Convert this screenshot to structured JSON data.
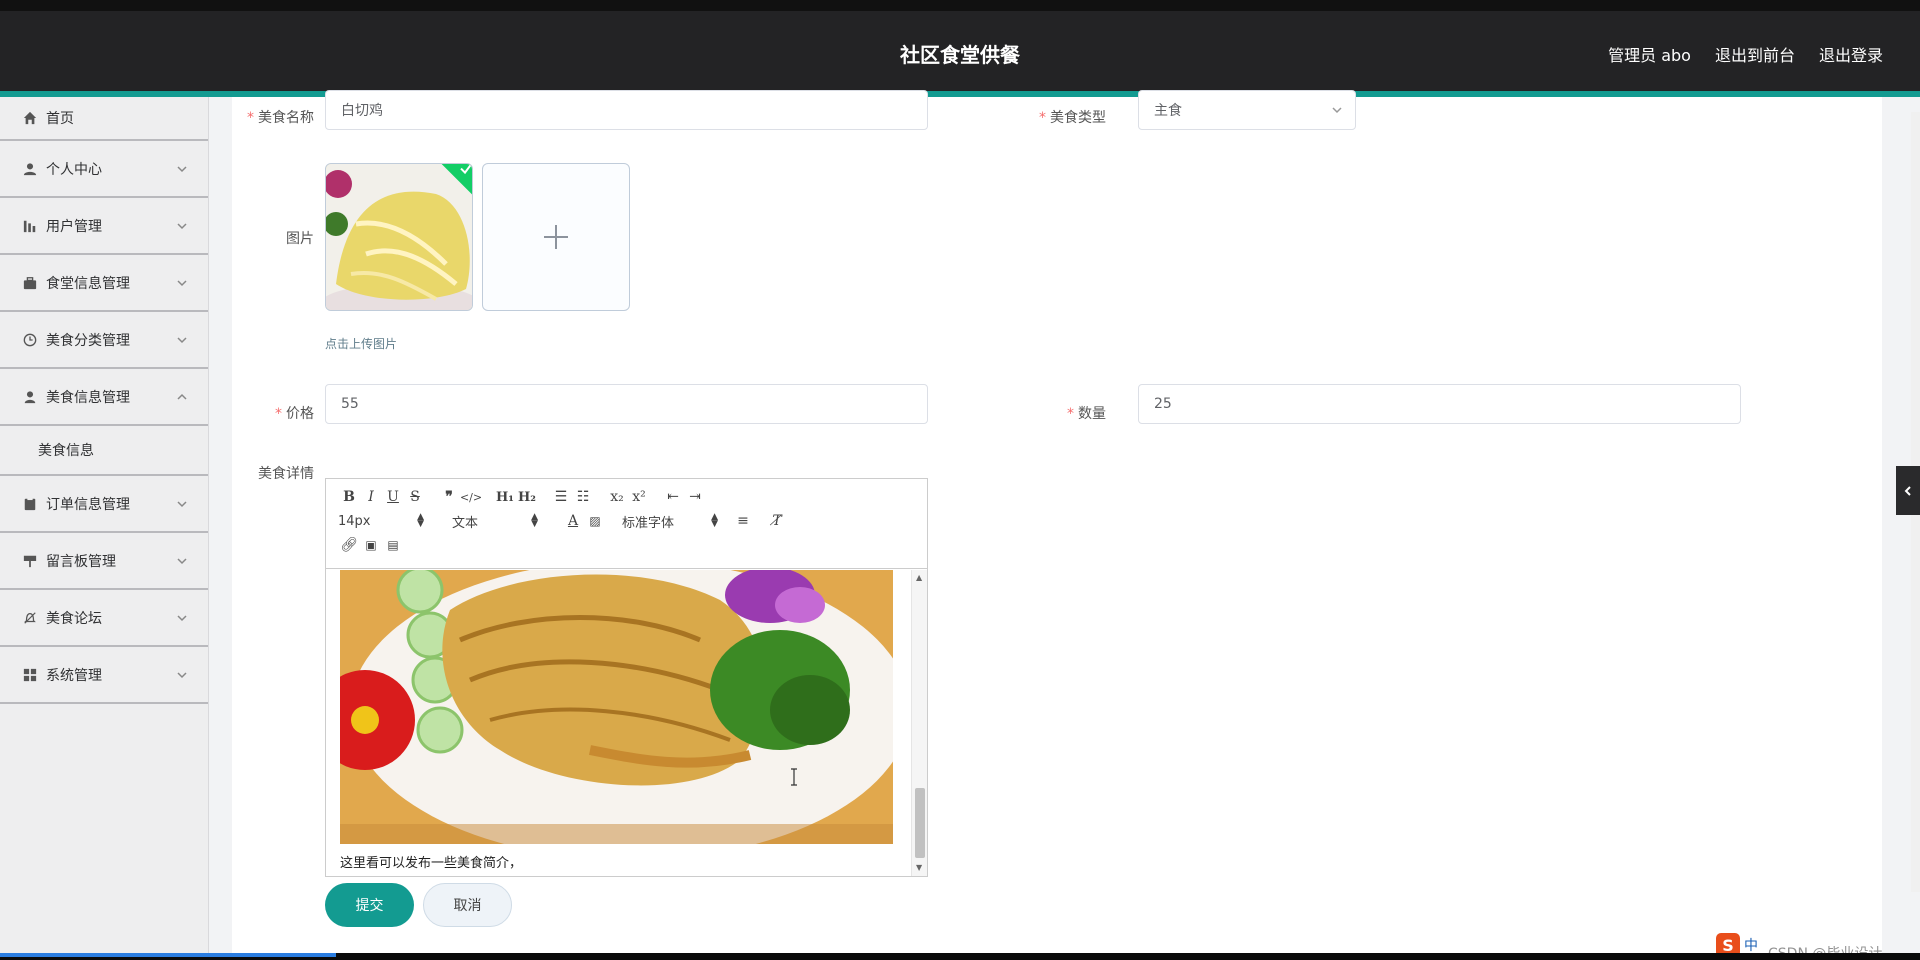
{
  "header": {
    "title": "社区食堂供餐",
    "links": [
      "管理员 abo",
      "退出到前台",
      "退出登录"
    ]
  },
  "sidebar": {
    "items": [
      {
        "label": "首页",
        "icon": "home-icon"
      },
      {
        "label": "个人中心",
        "icon": "user-icon"
      },
      {
        "label": "用户管理",
        "icon": "bar-chart-icon"
      },
      {
        "label": "食堂信息管理",
        "icon": "briefcase-icon"
      },
      {
        "label": "美食分类管理",
        "icon": "clock-icon"
      },
      {
        "label": "美食信息管理",
        "icon": "person-icon",
        "expanded": true
      },
      {
        "label": "订单信息管理",
        "icon": "clipboard-icon"
      },
      {
        "label": "留言板管理",
        "icon": "sign-icon"
      },
      {
        "label": "美食论坛",
        "icon": "bell-off-icon"
      },
      {
        "label": "系统管理",
        "icon": "grid-icon"
      }
    ],
    "sub_items": [
      "美食信息"
    ]
  },
  "form": {
    "name_label": "美食名称",
    "name_value": "白切鸡",
    "type_label": "美食类型",
    "type_value": "主食",
    "image_label": "图片",
    "upload_tip": "点击上传图片",
    "price_label": "价格",
    "price_value": "55",
    "qty_label": "数量",
    "qty_value": "25",
    "detail_label": "美食详情"
  },
  "editor": {
    "font_size": "14px",
    "block": "文本",
    "font_family": "标准字体",
    "text": "这里看可以发布一些美食简介，"
  },
  "buttons": {
    "submit": "提交",
    "cancel": "取消"
  },
  "ime": {
    "lang": "中"
  },
  "watermark": "CSDN @毕业设计"
}
